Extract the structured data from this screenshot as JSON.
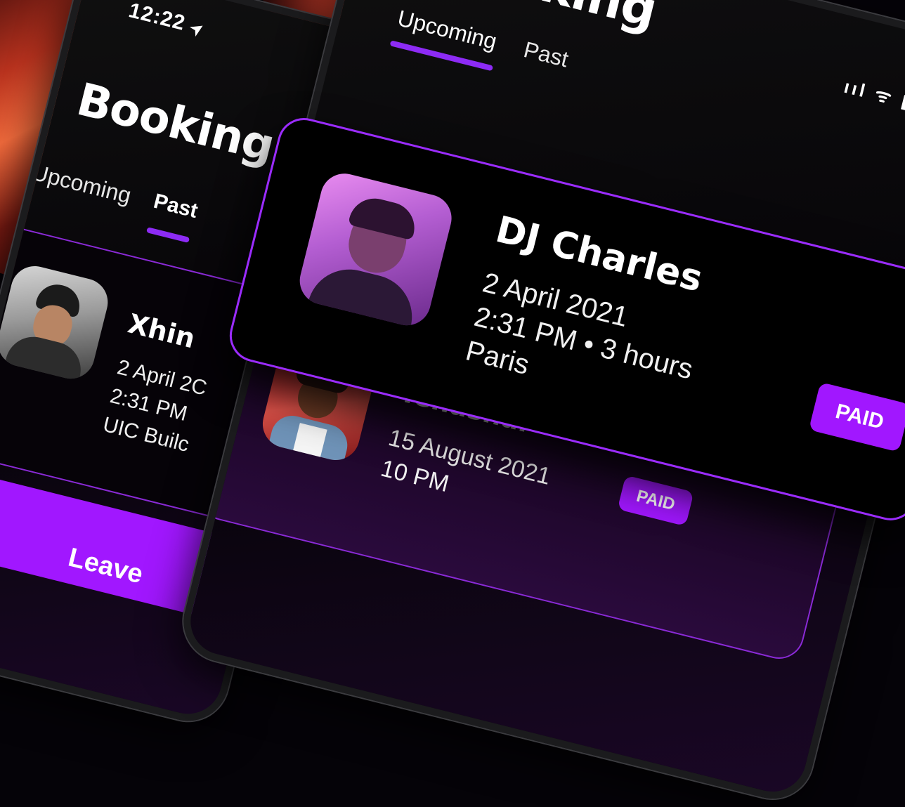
{
  "left_phone": {
    "status_time": "12:22",
    "location_arrow": "➤",
    "title": "Booking",
    "tabs": [
      {
        "label": "Upcoming",
        "active": false
      },
      {
        "label": "Past",
        "active": true
      }
    ],
    "card": {
      "name": "Xhin",
      "date": "2 April 2C",
      "time": "2:31 PM",
      "place": "UIC Builc"
    },
    "button_label": "Leave"
  },
  "right_phone": {
    "title": "Booking",
    "status_icons": "ııl ᯤ ▮",
    "tabs": [
      {
        "label": "Upcoming",
        "active": true
      },
      {
        "label": "Past",
        "active": false
      }
    ],
    "second_card": {
      "name": "Tenashar",
      "date": "15 August 2021",
      "time": "10 PM",
      "badge": "PAID",
      "arrow_icon": "→"
    }
  },
  "featured_card": {
    "name": "DJ Charles",
    "date": "2 April 2021",
    "time_duration": "2:31 PM • 3 hours",
    "place": "Paris",
    "badge": "PAID"
  },
  "colors": {
    "accent": "#a117ff",
    "accent_border": "#9b2cff",
    "background": "#050308"
  }
}
